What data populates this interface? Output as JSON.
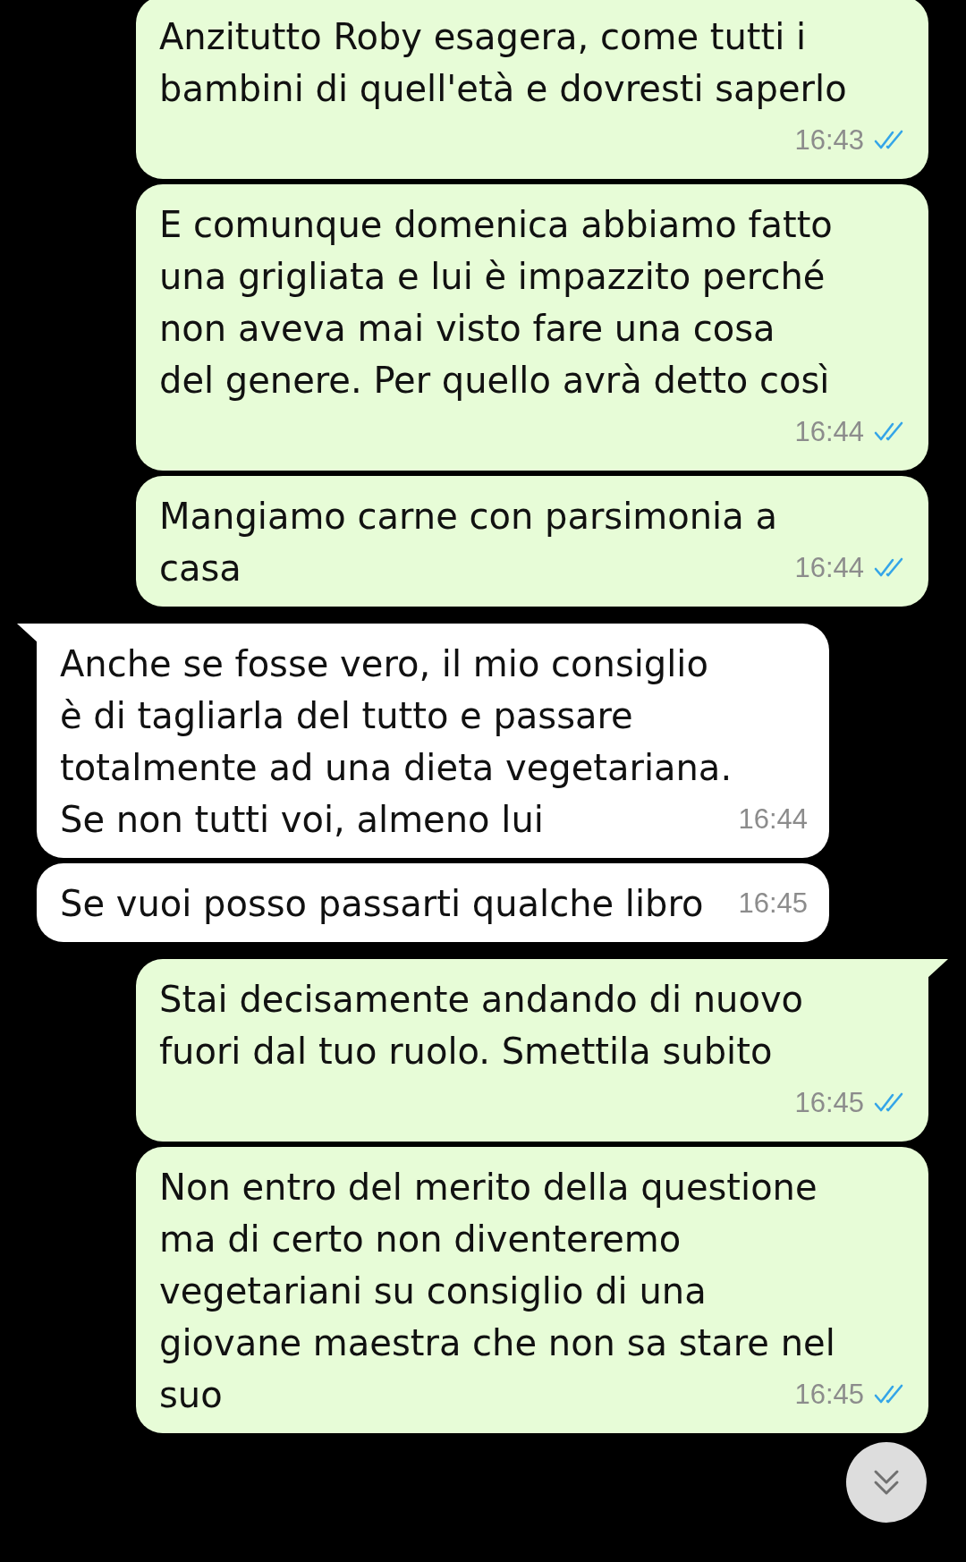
{
  "messages": [
    {
      "outgoing": true,
      "tail": false,
      "lines": [
        "Anzitutto Roby esagera, come tutti i",
        "bambini di quell'età e dovresti saperlo"
      ],
      "time": "16:43",
      "read": true
    },
    {
      "outgoing": true,
      "tail": false,
      "lines": [
        "E comunque domenica abbiamo fatto",
        "una grigliata e lui è impazzito perché",
        "non aveva mai visto fare una cosa",
        "del genere. Per quello avrà detto così"
      ],
      "time": "16:44",
      "read": true
    },
    {
      "outgoing": true,
      "tail": false,
      "lines": [
        "Mangiamo carne con parsimonia a",
        "casa"
      ],
      "time": "16:44",
      "read": true
    },
    {
      "outgoing": false,
      "tail": true,
      "lines": [
        "Anche se fosse vero, il mio consiglio",
        "è di tagliarla del tutto e passare",
        "totalmente ad una dieta vegetariana.",
        "Se non tutti voi, almeno lui"
      ],
      "time": "16:44"
    },
    {
      "outgoing": false,
      "tail": false,
      "lines": [
        "Se vuoi posso passarti qualche libro"
      ],
      "time": "16:45"
    },
    {
      "outgoing": true,
      "tail": true,
      "lines": [
        "Stai decisamente andando di nuovo",
        "fuori dal tuo ruolo. Smettila subito"
      ],
      "time": "16:45",
      "read": true
    },
    {
      "outgoing": true,
      "tail": false,
      "lines": [
        "Non entro del merito della questione",
        "ma di certo non diventeremo",
        "vegetariani su consiglio di una",
        "giovane maestra che non sa stare nel",
        "suo"
      ],
      "time": "16:45",
      "read": true
    }
  ]
}
